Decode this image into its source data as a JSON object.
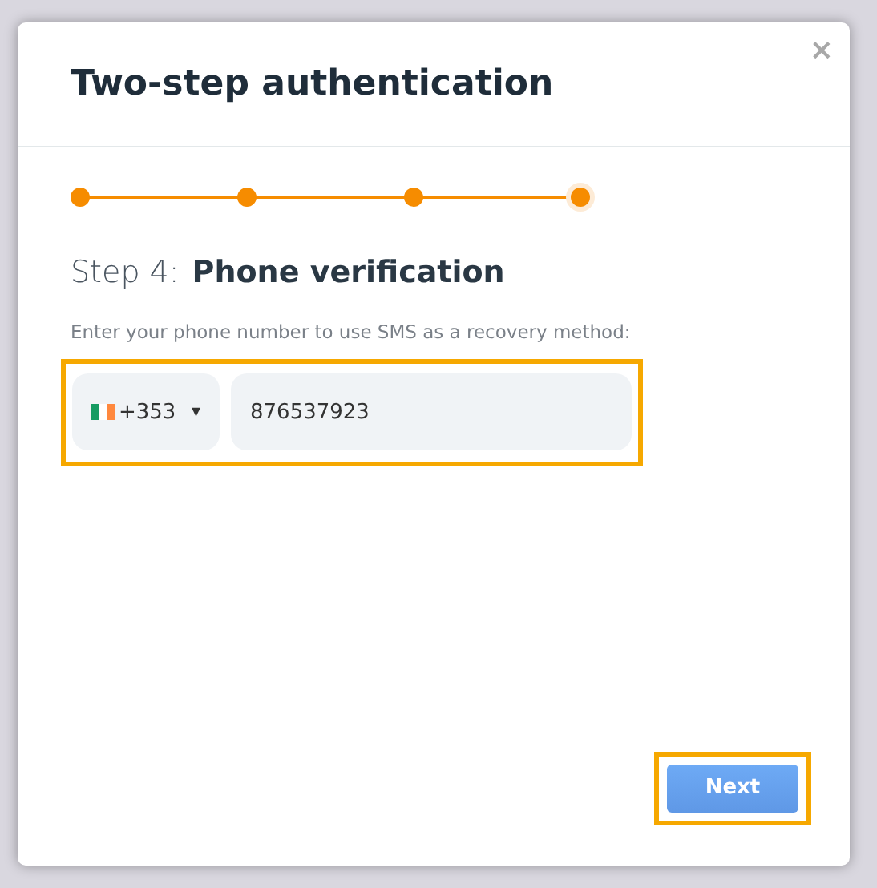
{
  "dialog": {
    "title": "Two-step authentication",
    "close": "×"
  },
  "steps": [
    {
      "selected": false
    },
    {
      "selected": false
    },
    {
      "selected": false
    },
    {
      "selected": true
    }
  ],
  "step_label": "Step 4:",
  "step_title": "Phone verification",
  "prompt": "Enter your phone number to use SMS as a recovery method:",
  "country": {
    "code": "+353",
    "caret": "▾"
  },
  "phone": {
    "value": "876537923"
  },
  "next_button": "Next"
}
